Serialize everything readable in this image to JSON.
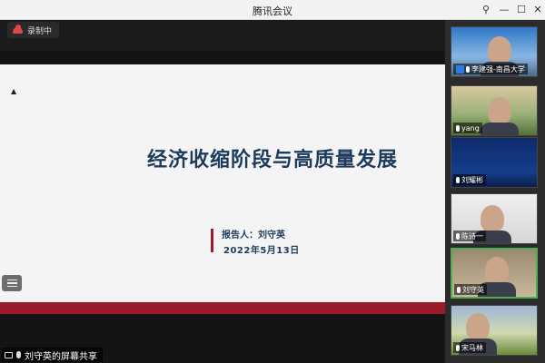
{
  "window": {
    "title": "腾讯会议"
  },
  "recording": {
    "label": "录制中"
  },
  "slide": {
    "title": "经济收缩阶段与高质量发展",
    "presenter": "报告人：刘守英",
    "date": "2022年5月13日"
  },
  "share": {
    "label": "刘守英的屏幕共享"
  },
  "participants": [
    {
      "name": "李建强-南昌大学"
    },
    {
      "name": "yang"
    },
    {
      "name": "刘耀彬"
    },
    {
      "name": "陈诗一"
    },
    {
      "name": "刘守英"
    },
    {
      "name": "宋马林"
    }
  ],
  "colors": {
    "accent_red": "#9b1b2b",
    "title_blue": "#1d3b5c",
    "active_speaker": "#4caf50"
  }
}
